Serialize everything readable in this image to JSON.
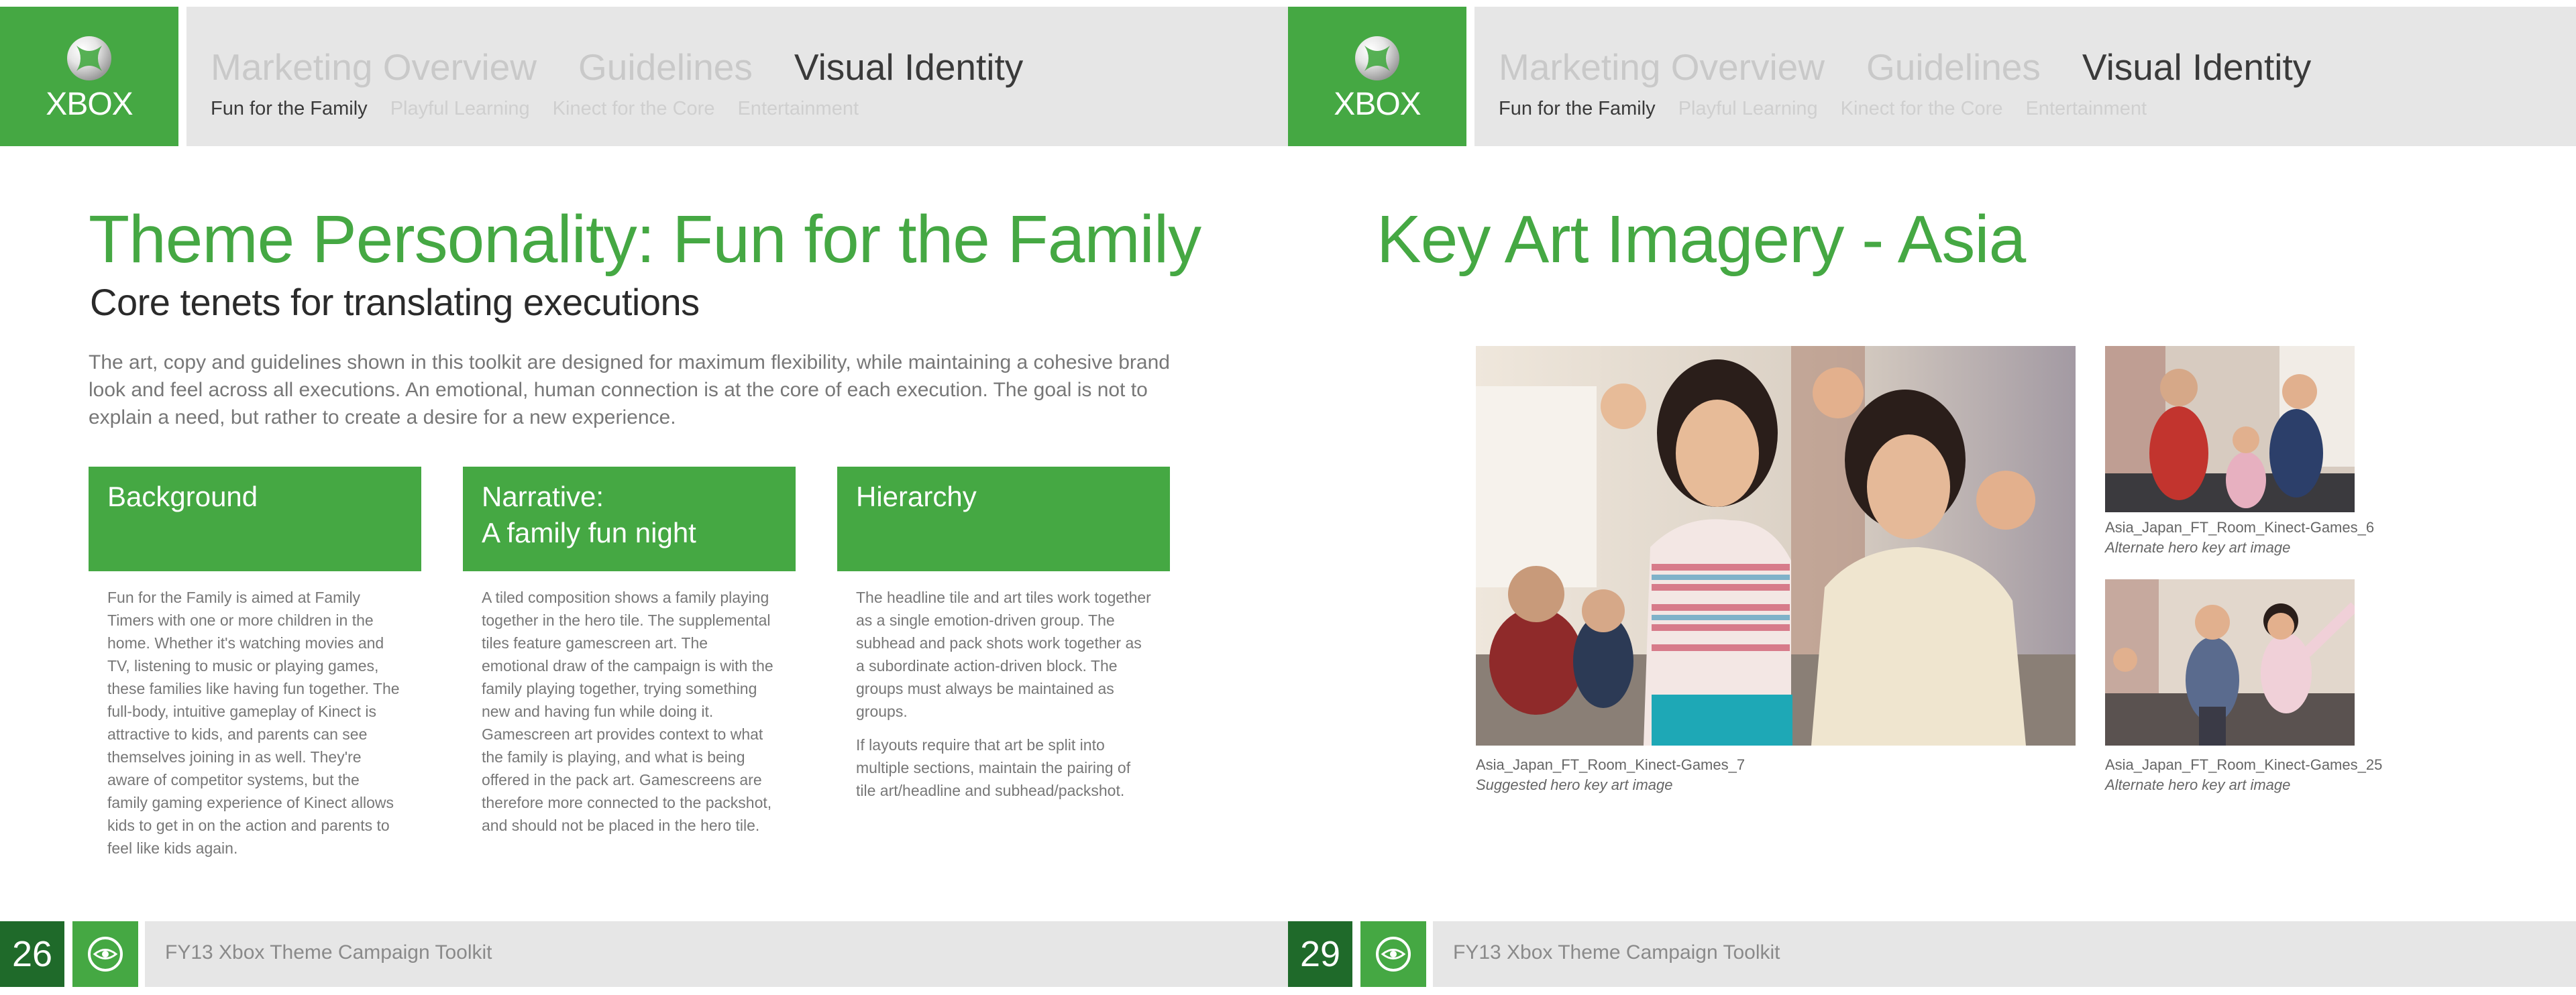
{
  "brand": {
    "logo_text": "XBOX",
    "green": "#45a843",
    "dark_green": "#1f6a2a"
  },
  "nav": {
    "primary": [
      "Marketing Overview",
      "Guidelines",
      "Visual Identity"
    ],
    "secondary": [
      "Fun for the Family",
      "Playful Learning",
      "Kinect for the Core",
      "Entertainment"
    ]
  },
  "left_page": {
    "title": "Theme Personality: Fun for the Family",
    "subtitle": "Core tenets for translating executions",
    "intro": "The art, copy and guidelines shown in this toolkit are designed for maximum flexibility, while maintaining a cohesive brand look and feel across all executions. An emotional, human connection is at the core of each execution. The goal is not to explain a need, but rather to create a desire for a new experience.",
    "cards": [
      {
        "heading": "Background",
        "paragraphs": [
          "Fun for the Family is aimed at Family Timers with one or more children in the home. Whether it's watching movies and TV, listening to music or playing games, these families like having fun together. The full-body, intuitive gameplay of Kinect is attractive to kids, and parents can see themselves joining in as well. They're aware of competitor systems, but the family gaming experience of Kinect allows kids to get in on the action and parents to feel like kids again."
        ]
      },
      {
        "heading": "Narrative:\nA family fun night",
        "paragraphs": [
          "A tiled composition shows a family playing together in the hero tile. The supplemental tiles feature gamescreen art. The emotional draw of the campaign is with the family playing together, trying something new and having fun while doing it. Gamescreen art provides context to what the family is playing, and what is being offered in the pack art. Gamescreens are therefore more connected to the packshot, and should not be placed in the hero tile."
        ]
      },
      {
        "heading": "Hierarchy",
        "paragraphs": [
          "The headline tile and art tiles work together as a single emotion-driven group. The subhead and pack shots work together as a subordinate action-driven block. The groups must always be maintained as groups.",
          "If layouts require that art be split into multiple sections, maintain the pairing of tile art/headline and subhead/packshot."
        ]
      }
    ],
    "page_number": "26",
    "footer_text": "FY13 Xbox Theme Campaign Toolkit"
  },
  "right_page": {
    "title": "Key Art Imagery - Asia",
    "images": [
      {
        "filename": "Asia_Japan_FT_Room_Kinect-Games_7",
        "description": "Suggested hero key art image"
      },
      {
        "filename": "Asia_Japan_FT_Room_Kinect-Games_6",
        "description": "Alternate hero key art image"
      },
      {
        "filename": "Asia_Japan_FT_Room_Kinect-Games_25",
        "description": "Alternate hero key art image"
      }
    ],
    "page_number": "29",
    "footer_text": "FY13 Xbox Theme Campaign Toolkit"
  }
}
